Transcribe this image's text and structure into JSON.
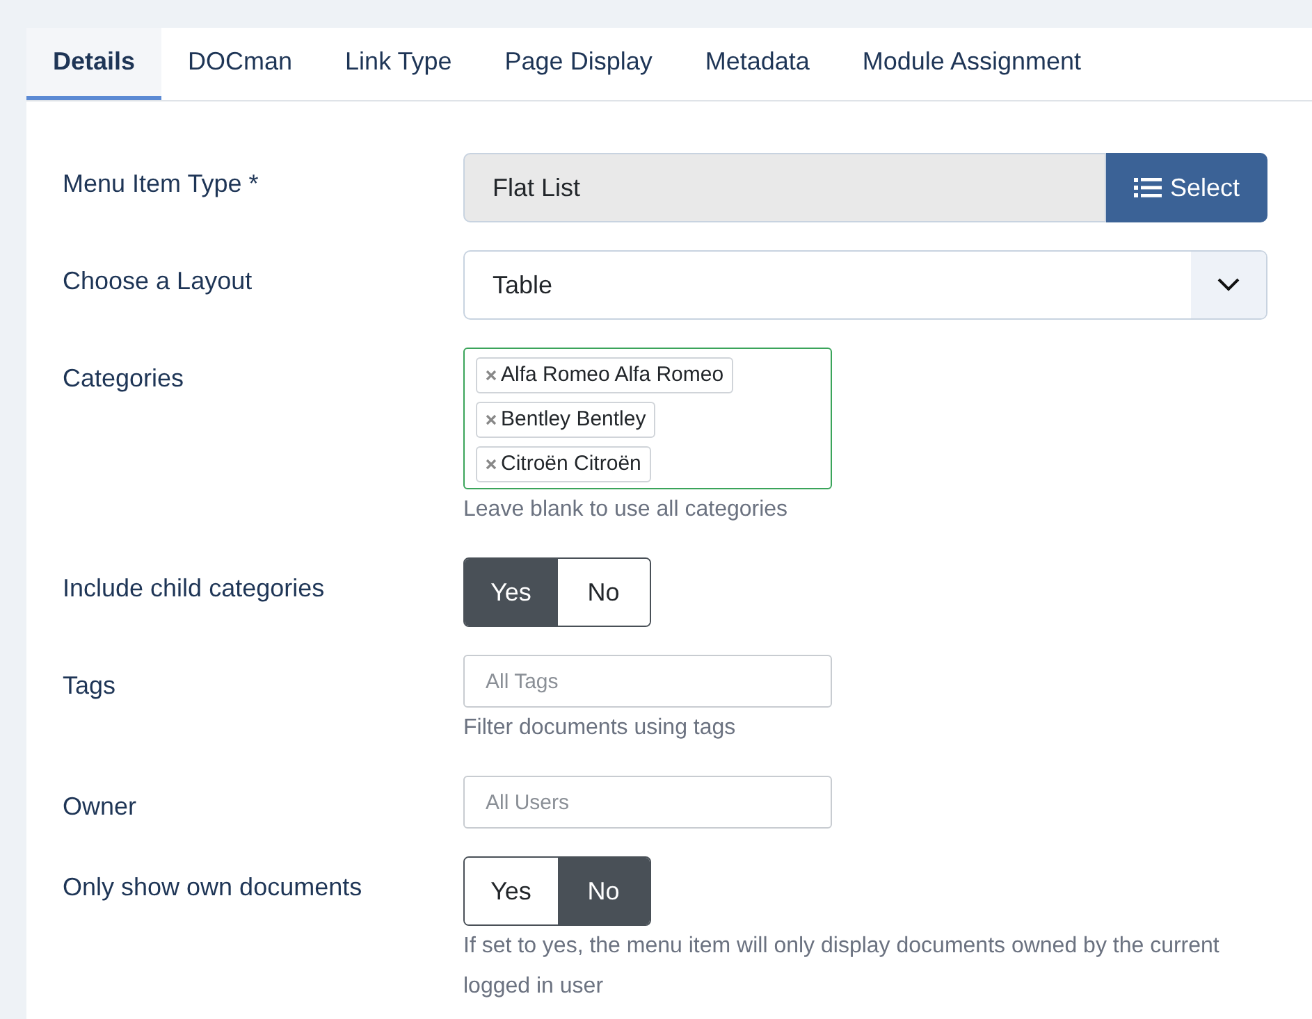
{
  "tabs": [
    {
      "label": "Details",
      "selected": true
    },
    {
      "label": "DOCman",
      "selected": false
    },
    {
      "label": "Link Type",
      "selected": false
    },
    {
      "label": "Page Display",
      "selected": false
    },
    {
      "label": "Metadata",
      "selected": false
    },
    {
      "label": "Module Assignment",
      "selected": false
    }
  ],
  "fields": [
    {
      "kind": "picker",
      "label": "Menu Item Type *",
      "value": "Flat List",
      "button": "Select"
    },
    {
      "kind": "dropdown",
      "label": "Choose a Layout",
      "value": "Table"
    },
    {
      "kind": "tags",
      "label": "Categories",
      "tags": [
        "Alfa Romeo Alfa Romeo",
        "Bentley Bentley",
        "Citroën Citroën"
      ],
      "help": "Leave blank to use all categories"
    },
    {
      "kind": "toggle",
      "label": "Include child categories",
      "options": [
        {
          "label": "Yes",
          "selected": true
        },
        {
          "label": "No",
          "selected": false
        }
      ]
    },
    {
      "kind": "text",
      "label": "Tags",
      "placeholder": "All Tags",
      "help": "Filter documents using tags"
    },
    {
      "kind": "text",
      "label": "Owner",
      "placeholder": "All Users"
    },
    {
      "kind": "toggle",
      "label": "Only show own documents",
      "options": [
        {
          "label": "Yes",
          "selected": false
        },
        {
          "label": "No",
          "selected": true
        }
      ],
      "help": "If set to yes, the menu item will only display documents owned by the current logged in user"
    }
  ]
}
